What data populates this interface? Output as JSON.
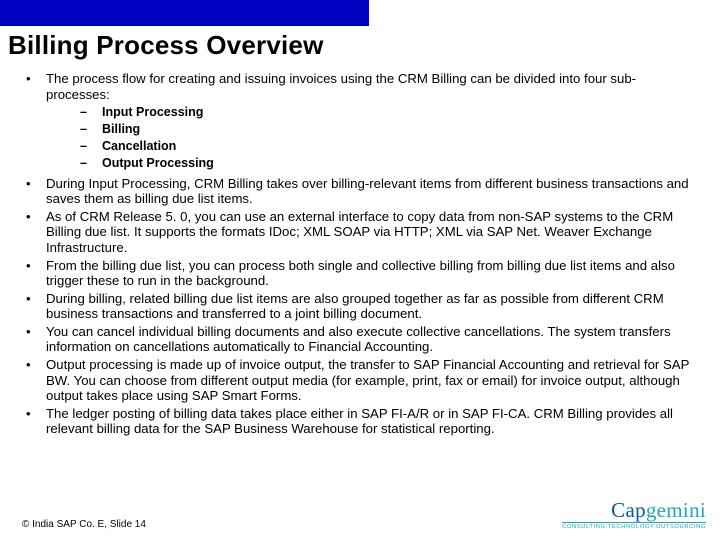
{
  "title": "Billing Process Overview",
  "intro": "The process flow for creating and issuing invoices using the CRM Billing can be divided into four sub-processes:",
  "sub_processes": [
    "Input Processing",
    " Billing",
    " Cancellation",
    " Output Processing"
  ],
  "paras": [
    "During Input Processing, CRM Billing takes over billing-relevant items from different business transactions and saves them as billing due list items.",
    "As of CRM Release 5. 0, you can use an external interface to copy data from non-SAP systems to the CRM Billing due list. It supports the formats IDoc; XML SOAP via HTTP; XML via SAP Net. Weaver Exchange Infrastructure.",
    " From the billing due list, you can process both single and collective billing from billing due list items and also trigger these to run in the background.",
    "During billing, related billing due list items are also grouped together as far as possible from different CRM business transactions and transferred to a joint billing document.",
    "You can cancel individual billing documents and also execute collective cancellations. The system transfers information on cancellations automatically to Financial Accounting.",
    "Output processing is made up of invoice output, the transfer to SAP Financial Accounting and retrieval for SAP BW. You can choose from different output media (for example, print, fax or email) for invoice output, although output takes place using SAP Smart Forms.",
    "The ledger posting of billing data takes place either in SAP FI-A/R or in SAP FI-CA. CRM Billing provides all relevant billing data for the SAP Business Warehouse for statistical reporting."
  ],
  "footer": "© India SAP Co. E, Slide 14",
  "logo": {
    "part1": "Cap",
    "part2": "gemini",
    "tag": "CONSULTING.TECHNOLOGY.OUTSOURCING"
  }
}
